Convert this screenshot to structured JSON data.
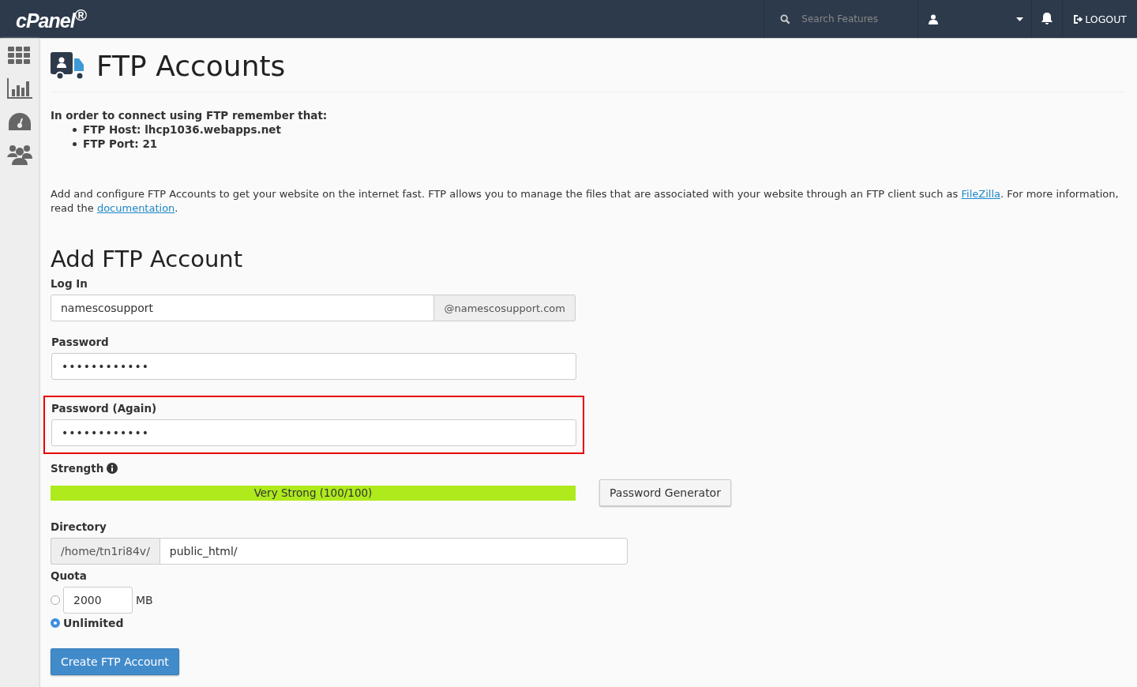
{
  "topbar": {
    "logo": "cPanel$^{®}$",
    "search": {
      "placeholder": "Search Features"
    },
    "logout": "LOGOUT"
  },
  "sidebar": {
    "items": [
      {
        "kind": "grid",
        "selected": false
      },
      {
        "kind": "chart",
        "selected": false
      },
      {
        "kind": "gauge",
        "selected": false
      },
      {
        "kind": "users",
        "selected": false
      }
    ]
  },
  "page": {
    "title": "FTP Accounts",
    "notice": {
      "heading": "In order to connect using FTP remember that:",
      "items": [
        "FTP Host: lhcp1036.webapps.net",
        "FTP Port: 21"
      ]
    },
    "intro": {
      "before": "Add and configure FTP Accounts to get your website on the internet fast. FTP allows you to manage the files that are associated with your website through an FTP client such as ",
      "link1": "FileZilla",
      "middle": ". For more information, read the ",
      "link2": "documentation",
      "after": "."
    }
  },
  "form": {
    "title": "Add FTP Account",
    "login": {
      "label": "Log In",
      "value": "namescosupport",
      "addon": "@namescosupport.com"
    },
    "password": {
      "label": "Password",
      "value": "••••••••••••",
      "highlighted": false
    },
    "password_again": {
      "label": "Password (Again)",
      "value": "••••••••••••",
      "highlighted": true
    },
    "strength": {
      "label": "Strength",
      "level": 1.0,
      "reading": "Very Strong (100/100)",
      "generator": "Password Generator"
    },
    "directory": {
      "label": "Directory",
      "prefix": "/home/tn1ri84v/",
      "value": "public_html/"
    },
    "quota": {
      "label": "Quota",
      "options": [
        {
          "kind": "amount",
          "value": "2000",
          "unit": "MB",
          "selected": false
        },
        {
          "kind": "label",
          "label": "Unlimited",
          "selected": true
        }
      ]
    },
    "submit": "Create FTP Account"
  }
}
